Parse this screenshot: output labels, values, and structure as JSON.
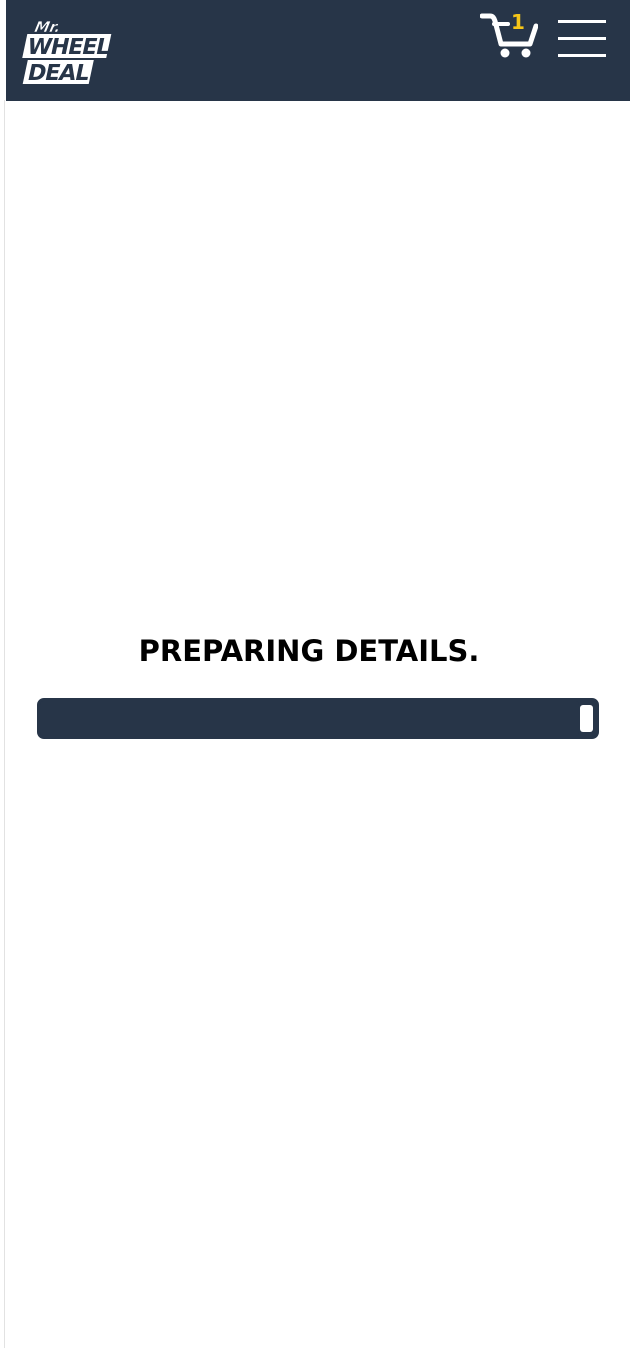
{
  "header": {
    "logo_text": "Mr. WHEEL DEAL",
    "cart": {
      "icon": "cart-icon",
      "count": "1"
    },
    "menu": {
      "icon": "hamburger-menu-icon"
    }
  },
  "loading": {
    "title": "PREPARING DETAILS.",
    "progress_percent": 97
  },
  "colors": {
    "header_bg": "#273548",
    "accent_yellow": "#f5c518",
    "progress_bar": "#273548"
  }
}
